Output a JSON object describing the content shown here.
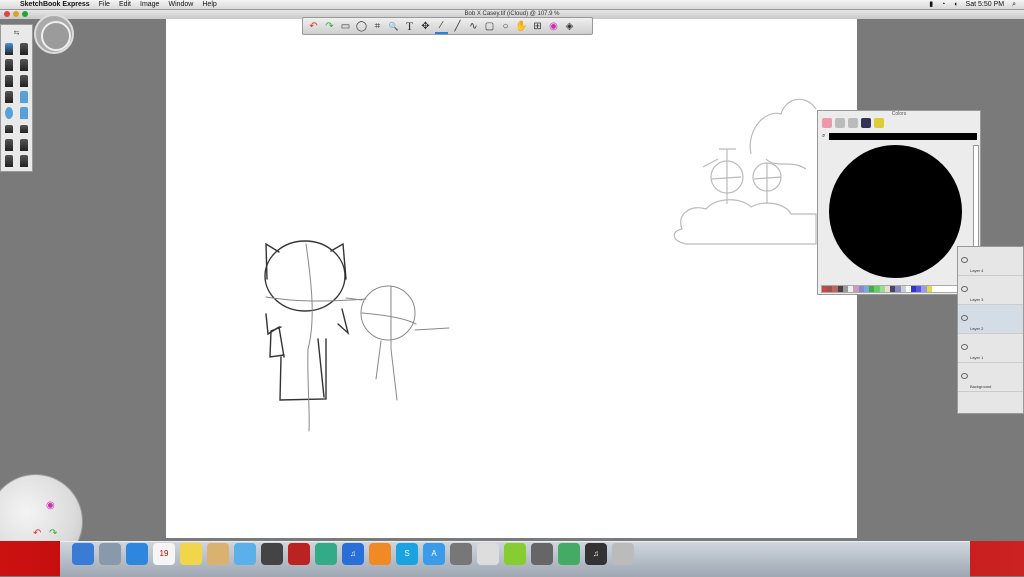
{
  "menubar": {
    "apple": "",
    "app_name": "SketchBook Express",
    "items": [
      "File",
      "Edit",
      "Image",
      "Window",
      "Help"
    ],
    "status": {
      "clock": "Sat 5:50 PM"
    }
  },
  "window": {
    "title": "Bob X Casey.tif (iCloud) @ 107.9 %"
  },
  "toolbar": {
    "icons": [
      "undo-icon",
      "redo-icon",
      "rect-select-icon",
      "lasso-icon",
      "crop-icon",
      "zoom-icon",
      "text-icon",
      "move-icon",
      "pencil-icon",
      "line-icon",
      "polyline-icon",
      "rectangle-icon",
      "ellipse-icon",
      "hand-icon",
      "brush-palette-icon",
      "color-wheel-icon",
      "layers-icon"
    ],
    "glyphs": [
      "↶",
      "↷",
      "▭",
      "◯",
      "⌗",
      "🔍",
      "T",
      "✥",
      "∕",
      "╱",
      "∿",
      "▢",
      "○",
      "✋",
      "⊞",
      "◉",
      "◈"
    ]
  },
  "colors_window": {
    "title": "Colors",
    "swatches": [
      "#c44",
      "#955",
      "#b66",
      "#444",
      "#999",
      "#eee",
      "#c9b",
      "#88c",
      "#7ad",
      "#4a4",
      "#6c6",
      "#9d9",
      "#edc",
      "#446",
      "#88b",
      "#ccd",
      "#fff",
      "#33c",
      "#55d",
      "#99e",
      "#dd4",
      "#fff",
      "#fff",
      "#fff",
      "#fff",
      "#fff",
      "#fff",
      "#fff",
      "#fff",
      "#fff"
    ]
  },
  "layers": [
    {
      "name": "Layer 4",
      "selected": false
    },
    {
      "name": "Layer 3",
      "selected": false
    },
    {
      "name": "Layer 2",
      "selected": true
    },
    {
      "name": "Layer 1",
      "selected": false
    },
    {
      "name": "Background",
      "selected": false
    }
  ],
  "dock": {
    "icons": [
      {
        "name": "finder-icon",
        "color": "#3a7bd5",
        "glyph": ""
      },
      {
        "name": "launchpad-icon",
        "color": "#8899aa",
        "glyph": ""
      },
      {
        "name": "safari-icon",
        "color": "#2e86de",
        "glyph": ""
      },
      {
        "name": "calendar-icon",
        "color": "#f5f5f5",
        "glyph": "19"
      },
      {
        "name": "stickies-icon",
        "color": "#f1d54b",
        "glyph": ""
      },
      {
        "name": "contacts-icon",
        "color": "#d9b26f",
        "glyph": ""
      },
      {
        "name": "messages-icon",
        "color": "#5ab0e8",
        "glyph": ""
      },
      {
        "name": "facetime-icon",
        "color": "#444",
        "glyph": ""
      },
      {
        "name": "photo-booth-icon",
        "color": "#b22",
        "glyph": ""
      },
      {
        "name": "iphoto-icon",
        "color": "#3a8",
        "glyph": ""
      },
      {
        "name": "itunes-icon",
        "color": "#2a6fd8",
        "glyph": "♫"
      },
      {
        "name": "ibooks-icon",
        "color": "#f08a24",
        "glyph": ""
      },
      {
        "name": "skype-icon",
        "color": "#1aa3e0",
        "glyph": "S"
      },
      {
        "name": "app-store-icon",
        "color": "#3a9be8",
        "glyph": "A"
      },
      {
        "name": "preview-icon",
        "color": "#777",
        "glyph": ""
      },
      {
        "name": "sketchbook-icon",
        "color": "#ddd",
        "glyph": ""
      },
      {
        "name": "note-app-icon",
        "color": "#8c3",
        "glyph": ""
      },
      {
        "name": "calculator-icon",
        "color": "#666",
        "glyph": ""
      },
      {
        "name": "preview-doc-icon",
        "color": "#4a6",
        "glyph": ""
      },
      {
        "name": "music-icon",
        "color": "#333",
        "glyph": "♫"
      },
      {
        "name": "trash-icon",
        "color": "#bbb",
        "glyph": ""
      }
    ]
  }
}
